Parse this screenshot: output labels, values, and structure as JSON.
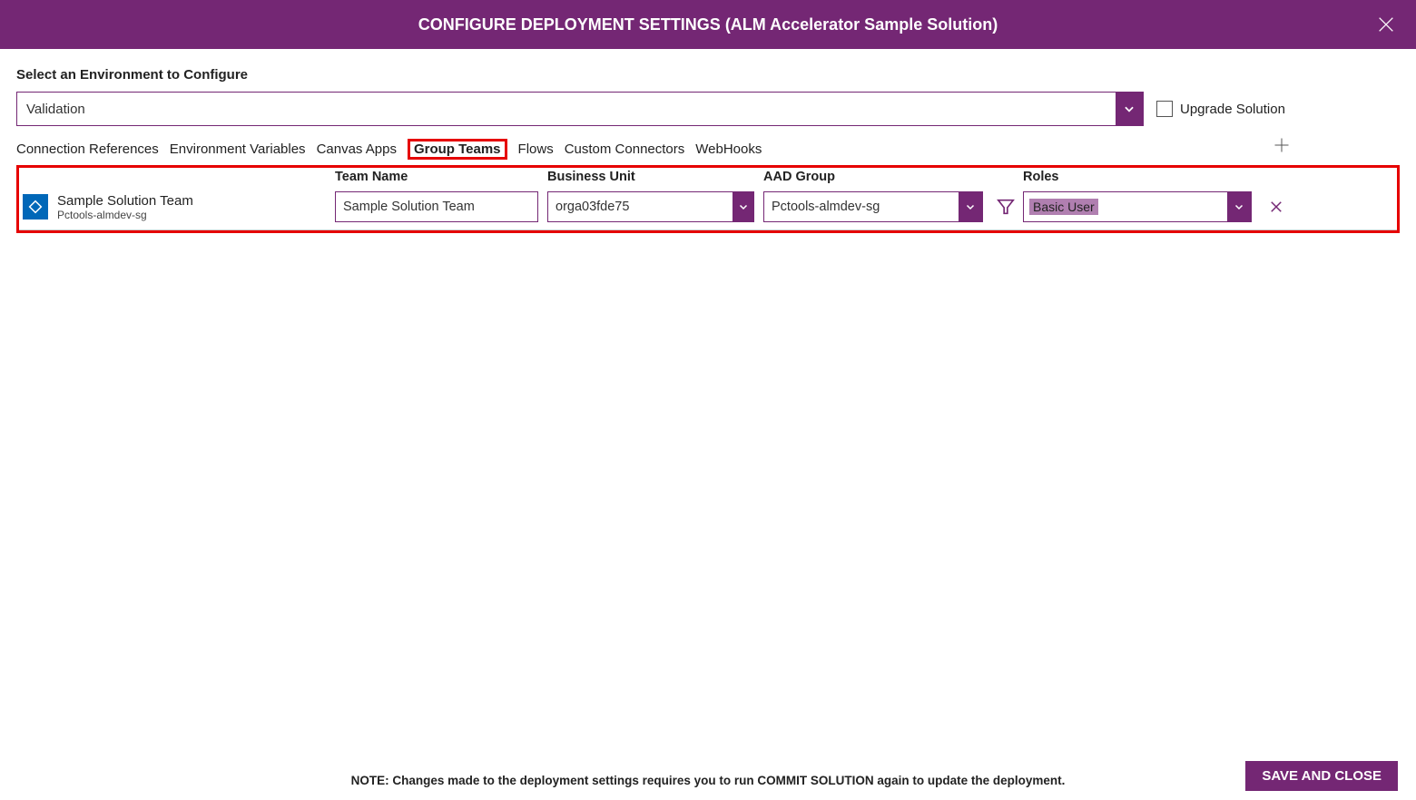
{
  "header": {
    "title": "CONFIGURE DEPLOYMENT SETTINGS (ALM Accelerator Sample Solution)"
  },
  "environment": {
    "label": "Select an Environment to Configure",
    "selected": "Validation",
    "upgrade_label": "Upgrade Solution"
  },
  "tabs": {
    "items": [
      "Connection References",
      "Environment Variables",
      "Canvas Apps",
      "Group Teams",
      "Flows",
      "Custom Connectors",
      "WebHooks"
    ],
    "active_index": 3
  },
  "columns": {
    "team_name": "Team Name",
    "business_unit": "Business Unit",
    "aad_group": "AAD Group",
    "roles": "Roles"
  },
  "rows": [
    {
      "icon": "team-icon",
      "title": "Sample Solution Team",
      "subtitle": "Pctools-almdev-sg",
      "team_name": "Sample Solution Team",
      "business_unit": "orga03fde75",
      "aad_group": "Pctools-almdev-sg",
      "roles_selected": "Basic User"
    }
  ],
  "footer": {
    "note": "NOTE: Changes made to the deployment settings requires you to run COMMIT SOLUTION again to update the deployment.",
    "save_label": "SAVE AND CLOSE"
  }
}
